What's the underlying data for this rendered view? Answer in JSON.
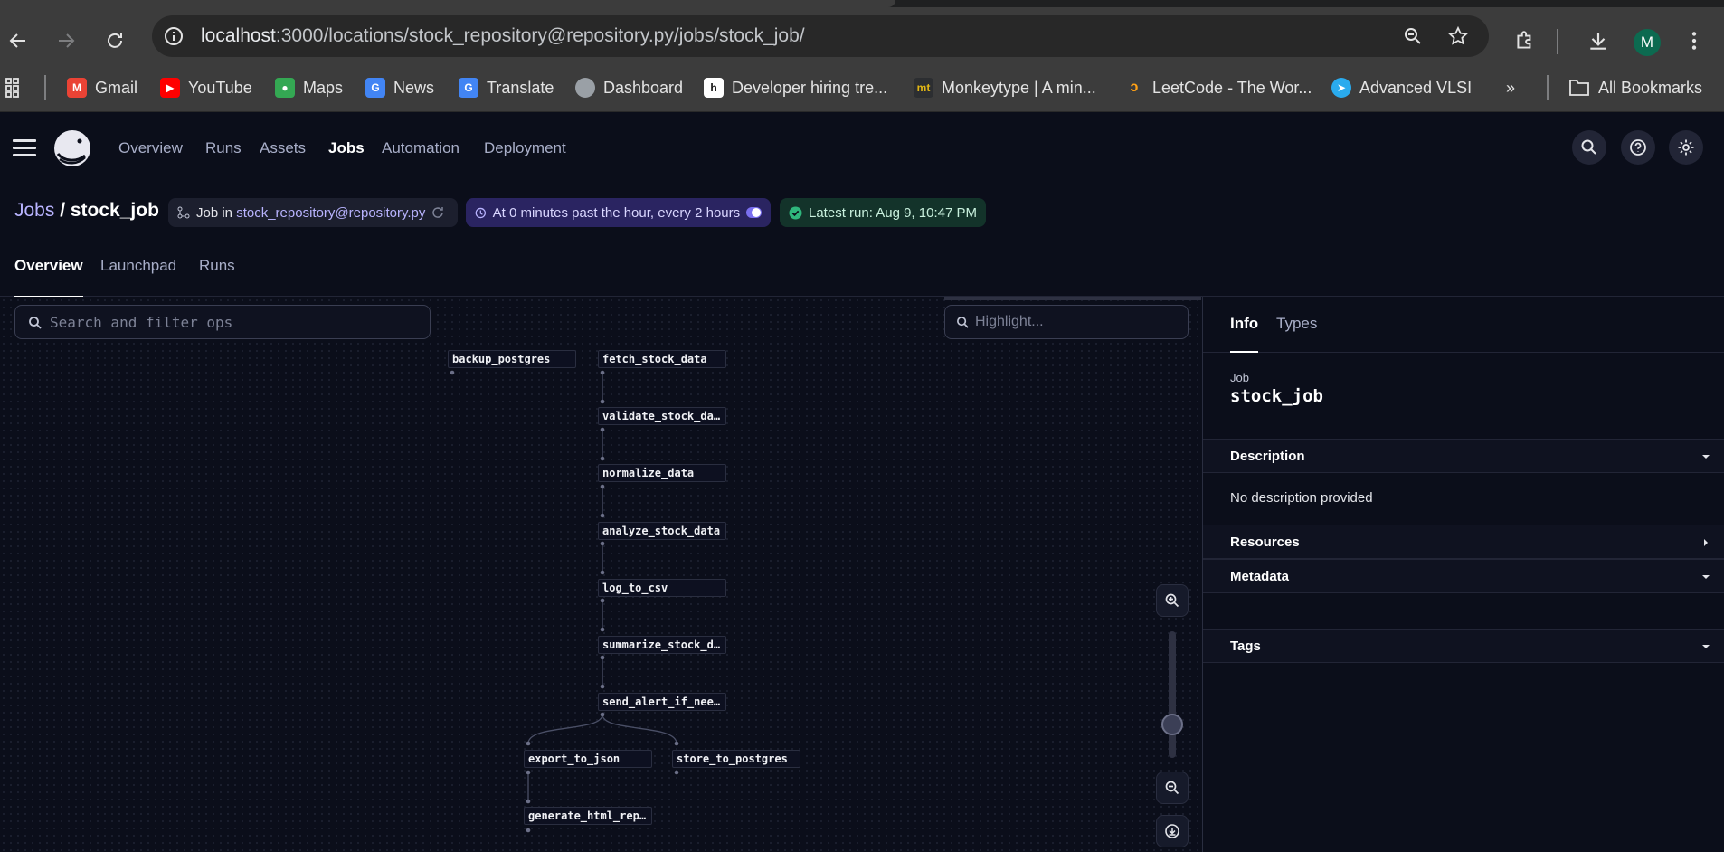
{
  "browser": {
    "url_host": "localhost",
    "url_path": ":3000/locations/stock_repository@repository.py/jobs/stock_job/",
    "avatar_letter": "M",
    "bookmarks": [
      {
        "label": "Gmail",
        "icon": "gmail-icon",
        "color": "#ea4335"
      },
      {
        "label": "YouTube",
        "icon": "youtube-icon",
        "color": "#ff0000"
      },
      {
        "label": "Maps",
        "icon": "maps-icon",
        "color": "#34a853"
      },
      {
        "label": "News",
        "icon": "news-icon",
        "color": "#4285f4"
      },
      {
        "label": "Translate",
        "icon": "translate-icon",
        "color": "#4285f4"
      },
      {
        "label": "Dashboard",
        "icon": "globe-icon",
        "color": "#9aa0a6"
      },
      {
        "label": "Developer hiring tre...",
        "icon": "h-icon",
        "color": "#ffffff"
      },
      {
        "label": "Monkeytype | A min...",
        "icon": "monkeytype-icon",
        "color": "#e2b714"
      },
      {
        "label": "LeetCode - The Wor...",
        "icon": "leetcode-icon",
        "color": "#ffa116"
      },
      {
        "label": "Advanced VLSI",
        "icon": "telegram-icon",
        "color": "#2aabee"
      }
    ],
    "more_label": "»",
    "all_bookmarks": "All Bookmarks"
  },
  "app": {
    "nav": [
      "Overview",
      "Runs",
      "Assets",
      "Jobs",
      "Automation",
      "Deployment"
    ],
    "active_nav": "Jobs",
    "breadcrumb_root": "Jobs",
    "breadcrumb_sep": " / ",
    "breadcrumb_current": "stock_job",
    "job_chip_prefix": "Job in ",
    "job_chip_repo": "stock_repository@repository.py",
    "schedule_chip": "At 0 minutes past the hour, every 2 hours",
    "latest_run_label": "Latest run: ",
    "latest_run_value": "Aug 9, 10:47 PM",
    "tabs": [
      "Overview",
      "Launchpad",
      "Runs"
    ],
    "accent": "#7a6ff0"
  },
  "graph": {
    "search_placeholder": "Search and filter ops",
    "highlight_placeholder": "Highlight...",
    "ops": [
      "backup_postgres",
      "fetch_stock_data",
      "validate_stock_da...",
      "normalize_data",
      "analyze_stock_data",
      "log_to_csv",
      "summarize_stock_d...",
      "send_alert_if_nee...",
      "export_to_json",
      "store_to_postgres",
      "generate_html_rep..."
    ]
  },
  "panel": {
    "tabs": [
      "Info",
      "Types"
    ],
    "kicker": "Job",
    "title": "stock_job",
    "sections": [
      "Description",
      "Resources",
      "Metadata",
      "Tags"
    ],
    "description_text": "No description provided"
  }
}
